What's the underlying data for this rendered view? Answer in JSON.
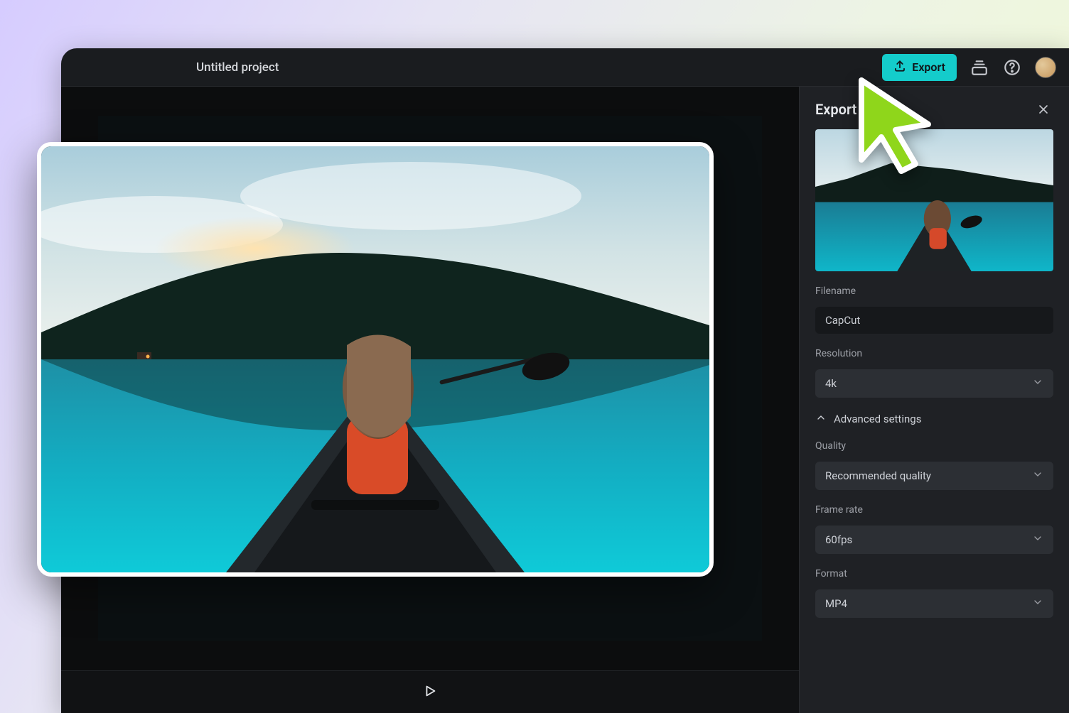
{
  "project": {
    "name": "Untitled project"
  },
  "header": {
    "export_label": "Export"
  },
  "export_panel": {
    "title": "Export",
    "filename_label": "Filename",
    "filename_value": "CapCut",
    "resolution_label": "Resolution",
    "resolution_value": "4k",
    "advanced_label": "Advanced settings",
    "quality_label": "Quality",
    "quality_value": "Recommended quality",
    "framerate_label": "Frame rate",
    "framerate_value": "60fps",
    "format_label": "Format",
    "format_value": "MP4"
  },
  "icons": {
    "export": "upload-icon",
    "tray": "tray-stack-icon",
    "help": "help-circle-icon",
    "close": "close-icon",
    "chevron_down": "chevron-down-icon",
    "chevron_up": "chevron-up-icon",
    "play": "play-icon"
  }
}
